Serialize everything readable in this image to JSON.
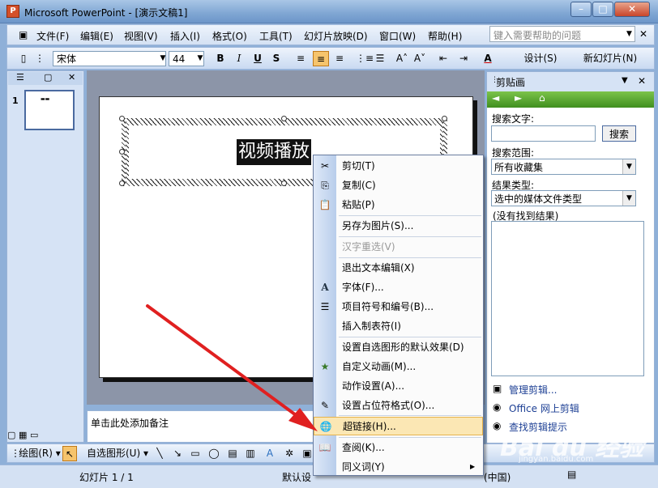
{
  "window": {
    "title": "Microsoft PowerPoint - [演示文稿1]",
    "min": "–",
    "max": "□",
    "close": "✕"
  },
  "menu": {
    "items": [
      "文件(F)",
      "编辑(E)",
      "视图(V)",
      "插入(I)",
      "格式(O)",
      "工具(T)",
      "幻灯片放映(D)",
      "窗口(W)",
      "帮助(H)"
    ],
    "help_placeholder": "键入需要帮助的问题",
    "help_dropdown": "▼",
    "doc_close": "✕"
  },
  "toolbar": {
    "font": "宋体",
    "font_size": "44",
    "bold": "B",
    "italic": "I",
    "underline": "U",
    "shadow": "S",
    "font_color": "A",
    "design_label": "设计(S)",
    "new_slide_label": "新幻灯片(N)"
  },
  "slides_pane": {
    "tab_outline": "☰",
    "tab_slides": "▢",
    "close": "✕",
    "slide_number": "1",
    "thumb_text": "▬▬"
  },
  "slide": {
    "title_text": "视频播放"
  },
  "notes": {
    "placeholder": "单击此处添加备注"
  },
  "draw_toolbar": {
    "draw_label": "绘图(R) ▾",
    "autoshapes_label": "自选图形(U) ▾"
  },
  "status": {
    "slide_count": "幻灯片 1 / 1",
    "design": "默认设",
    "language": "(中国)"
  },
  "clipboard_pane": {
    "title": "剪贴画",
    "search_label": "搜索文字:",
    "search_value": "",
    "search_button": "搜索",
    "scope_label": "搜索范围:",
    "scope_value": "所有收藏集",
    "type_label": "结果类型:",
    "type_value": "选中的媒体文件类型",
    "results_text": "(没有找到结果)",
    "links": [
      "管理剪辑...",
      "Office 网上剪辑",
      "查找剪辑提示"
    ],
    "dropdown": "▼"
  },
  "context_menu": {
    "items": [
      {
        "label": "剪切(T)",
        "icon": "✂",
        "disabled": false
      },
      {
        "label": "复制(C)",
        "icon": "⎘",
        "disabled": false
      },
      {
        "label": "粘贴(P)",
        "icon": "📋",
        "disabled": false
      },
      {
        "label": "另存为图片(S)...",
        "icon": "",
        "disabled": false
      },
      {
        "label": "汉字重选(V)",
        "icon": "",
        "disabled": true
      },
      {
        "label": "退出文本编辑(X)",
        "icon": "",
        "disabled": false
      },
      {
        "label": "字体(F)...",
        "icon": "A",
        "disabled": false
      },
      {
        "label": "项目符号和编号(B)...",
        "icon": "☰",
        "disabled": false
      },
      {
        "label": "插入制表符(I)",
        "icon": "",
        "disabled": false
      },
      {
        "label": "设置自选图形的默认效果(D)",
        "icon": "",
        "disabled": false
      },
      {
        "label": "自定义动画(M)...",
        "icon": "★",
        "disabled": false
      },
      {
        "label": "动作设置(A)...",
        "icon": "",
        "disabled": false
      },
      {
        "label": "设置占位符格式(O)...",
        "icon": "✎",
        "disabled": false
      },
      {
        "label": "超链接(H)...",
        "icon": "🌐",
        "disabled": false
      },
      {
        "label": "查阅(K)...",
        "icon": "📖",
        "disabled": false
      },
      {
        "label": "同义词(Y)",
        "icon": "",
        "disabled": false,
        "submenu": "▶"
      }
    ],
    "highlighted": "超链接(H)..."
  },
  "watermark": {
    "text": "Bai du 经验",
    "sub": "jingyan.baidu.com"
  },
  "colors": {
    "arrow": "#e02020",
    "highlight": "#fbe7b4",
    "title_bar": "#7fa6d3"
  }
}
